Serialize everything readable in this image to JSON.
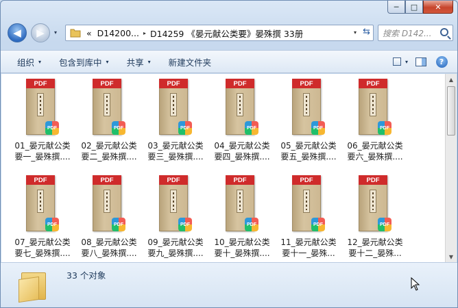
{
  "window": {
    "caption_buttons": [
      "─",
      "□",
      "✕"
    ]
  },
  "nav": {
    "back_glyph": "◀",
    "forward_glyph": "▶",
    "history_glyph": "▾",
    "address": {
      "overflow": "«",
      "segments": [
        "D14200...",
        "D14259 《晏元献公类要》晏殊撰 33册"
      ],
      "separator": "▸",
      "dropdown_glyph": "▾",
      "refresh_glyph": "⇆"
    },
    "search": {
      "placeholder": "搜索 D142..."
    }
  },
  "toolbar": {
    "items": [
      {
        "label": "组织",
        "caret": "▾"
      },
      {
        "label": "包含到库中",
        "caret": "▾"
      },
      {
        "label": "共享",
        "caret": "▾"
      },
      {
        "label": "新建文件夹",
        "caret": ""
      }
    ],
    "view_caret": "▾",
    "help_glyph": "?"
  },
  "files": {
    "pdf_band": "PDF",
    "badge_text": "PDF",
    "items": [
      {
        "label": "01_晏元献公类要一_晏殊撰...."
      },
      {
        "label": "02_晏元献公类要二_晏殊撰...."
      },
      {
        "label": "03_晏元献公类要三_晏殊撰...."
      },
      {
        "label": "04_晏元献公类要四_晏殊撰...."
      },
      {
        "label": "05_晏元献公类要五_晏殊撰...."
      },
      {
        "label": "06_晏元献公类要六_晏殊撰...."
      },
      {
        "label": "07_晏元献公类要七_晏殊撰...."
      },
      {
        "label": "08_晏元献公类要八_晏殊撰...."
      },
      {
        "label": "09_晏元献公类要九_晏殊撰...."
      },
      {
        "label": "10_晏元献公类要十_晏殊撰...."
      },
      {
        "label": "11_晏元献公类要十一_晏殊..."
      },
      {
        "label": "12_晏元献公类要十二_晏殊..."
      }
    ]
  },
  "scrollbar": {
    "up_glyph": "▲",
    "down_glyph": "▼"
  },
  "status": {
    "count_text": "33 个对象"
  },
  "colors": {
    "pdf_red": "#cf2b2b",
    "toolbar_text": "#1e395b",
    "window_frame": "#c7d9ee"
  }
}
